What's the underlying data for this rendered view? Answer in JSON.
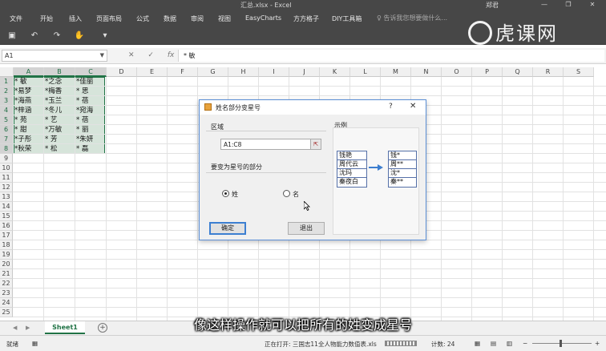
{
  "window": {
    "title": "汇总.xlsx - Excel",
    "user": "郑君",
    "min": "—",
    "restore": "❐",
    "close": "✕"
  },
  "ribbon": {
    "tabs": [
      "文件",
      "开始",
      "插入",
      "页面布局",
      "公式",
      "数据",
      "审阅",
      "视图",
      "EasyCharts",
      "方方格子",
      "DIY工具箱"
    ],
    "tell_me": "♀ 告诉我您想要做什么..."
  },
  "watermark": "虎课网",
  "formula_bar": {
    "name_box": "A1",
    "cancel": "✕",
    "enter": "✓",
    "fx": "fx",
    "content": "* 敏"
  },
  "grid": {
    "columns": [
      "A",
      "B",
      "C",
      "D",
      "E",
      "F",
      "G",
      "H",
      "I",
      "J",
      "K",
      "L",
      "M",
      "N",
      "O",
      "P",
      "Q",
      "R",
      "S"
    ],
    "rows": [
      "1",
      "2",
      "3",
      "4",
      "5",
      "6",
      "7",
      "8",
      "9",
      "10",
      "11",
      "12",
      "13",
      "14",
      "15",
      "16",
      "17",
      "18",
      "19",
      "20",
      "21",
      "22",
      "23",
      "24",
      "25"
    ],
    "data": [
      [
        "*  敏",
        "*之念",
        "*佳丽"
      ],
      [
        "*易梦",
        "*梅香",
        "*  思"
      ],
      [
        "*海燕",
        "*玉兰",
        "*  蓓"
      ],
      [
        "*梓涵",
        "*冬儿",
        "*宛海"
      ],
      [
        "*  苑",
        "*  艺",
        "*  蓓"
      ],
      [
        "*  甜",
        "*万敏",
        "*  丽"
      ],
      [
        "*子彤",
        "*  芳",
        "*朱妍"
      ],
      [
        "*秋荣",
        "*  松",
        "*  磊"
      ]
    ]
  },
  "dialog": {
    "title": "姓名部分变星号",
    "help": "?",
    "close": "✕",
    "region_label": "区域",
    "range_value": "A1:C8",
    "range_btn": "⇱",
    "part_label": "要变为星号的部分",
    "radio_surname": "姓",
    "radio_given": "名",
    "ok": "确定",
    "exit": "退出",
    "example_label": "示例",
    "example_before": [
      "钱艳",
      "周代云",
      "沈玛",
      "秦夜白"
    ],
    "example_after": [
      "钱*",
      "周**",
      "沈*",
      "秦**"
    ]
  },
  "sheets": {
    "active": "Sheet1",
    "add": "+",
    "nav_prev": "◀",
    "nav_next": "▶"
  },
  "status": {
    "ready": "就绪",
    "opening": "正在打开: 三国志11全人物能力数值表.xls",
    "count": "计数: 24"
  },
  "subtitle": "像这样操作就可以把所有的姓变成星号"
}
